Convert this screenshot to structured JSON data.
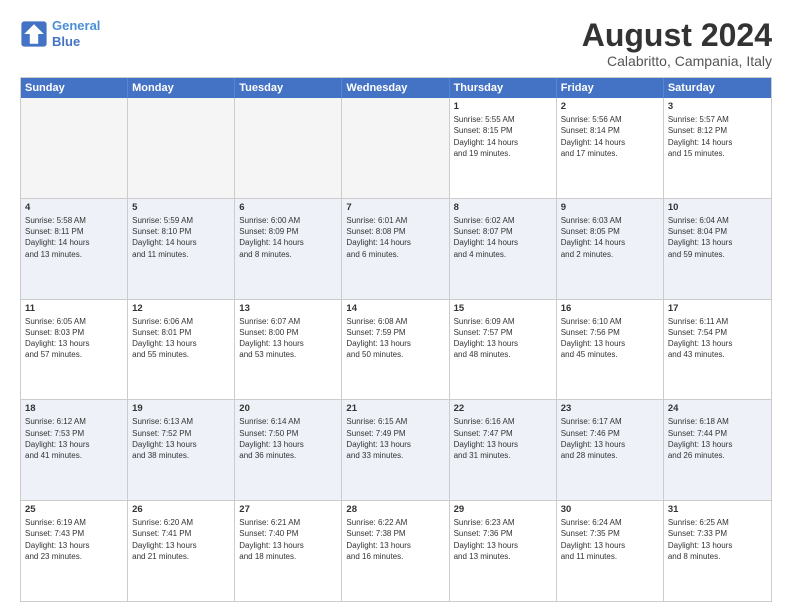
{
  "logo": {
    "line1": "General",
    "line2": "Blue"
  },
  "title": "August 2024",
  "subtitle": "Calabritto, Campania, Italy",
  "weekdays": [
    "Sunday",
    "Monday",
    "Tuesday",
    "Wednesday",
    "Thursday",
    "Friday",
    "Saturday"
  ],
  "rows": [
    {
      "alt": false,
      "cells": [
        {
          "empty": true,
          "day": "",
          "info": ""
        },
        {
          "empty": true,
          "day": "",
          "info": ""
        },
        {
          "empty": true,
          "day": "",
          "info": ""
        },
        {
          "empty": true,
          "day": "",
          "info": ""
        },
        {
          "empty": false,
          "day": "1",
          "info": "Sunrise: 5:55 AM\nSunset: 8:15 PM\nDaylight: 14 hours\nand 19 minutes."
        },
        {
          "empty": false,
          "day": "2",
          "info": "Sunrise: 5:56 AM\nSunset: 8:14 PM\nDaylight: 14 hours\nand 17 minutes."
        },
        {
          "empty": false,
          "day": "3",
          "info": "Sunrise: 5:57 AM\nSunset: 8:12 PM\nDaylight: 14 hours\nand 15 minutes."
        }
      ]
    },
    {
      "alt": true,
      "cells": [
        {
          "empty": false,
          "day": "4",
          "info": "Sunrise: 5:58 AM\nSunset: 8:11 PM\nDaylight: 14 hours\nand 13 minutes."
        },
        {
          "empty": false,
          "day": "5",
          "info": "Sunrise: 5:59 AM\nSunset: 8:10 PM\nDaylight: 14 hours\nand 11 minutes."
        },
        {
          "empty": false,
          "day": "6",
          "info": "Sunrise: 6:00 AM\nSunset: 8:09 PM\nDaylight: 14 hours\nand 8 minutes."
        },
        {
          "empty": false,
          "day": "7",
          "info": "Sunrise: 6:01 AM\nSunset: 8:08 PM\nDaylight: 14 hours\nand 6 minutes."
        },
        {
          "empty": false,
          "day": "8",
          "info": "Sunrise: 6:02 AM\nSunset: 8:07 PM\nDaylight: 14 hours\nand 4 minutes."
        },
        {
          "empty": false,
          "day": "9",
          "info": "Sunrise: 6:03 AM\nSunset: 8:05 PM\nDaylight: 14 hours\nand 2 minutes."
        },
        {
          "empty": false,
          "day": "10",
          "info": "Sunrise: 6:04 AM\nSunset: 8:04 PM\nDaylight: 13 hours\nand 59 minutes."
        }
      ]
    },
    {
      "alt": false,
      "cells": [
        {
          "empty": false,
          "day": "11",
          "info": "Sunrise: 6:05 AM\nSunset: 8:03 PM\nDaylight: 13 hours\nand 57 minutes."
        },
        {
          "empty": false,
          "day": "12",
          "info": "Sunrise: 6:06 AM\nSunset: 8:01 PM\nDaylight: 13 hours\nand 55 minutes."
        },
        {
          "empty": false,
          "day": "13",
          "info": "Sunrise: 6:07 AM\nSunset: 8:00 PM\nDaylight: 13 hours\nand 53 minutes."
        },
        {
          "empty": false,
          "day": "14",
          "info": "Sunrise: 6:08 AM\nSunset: 7:59 PM\nDaylight: 13 hours\nand 50 minutes."
        },
        {
          "empty": false,
          "day": "15",
          "info": "Sunrise: 6:09 AM\nSunset: 7:57 PM\nDaylight: 13 hours\nand 48 minutes."
        },
        {
          "empty": false,
          "day": "16",
          "info": "Sunrise: 6:10 AM\nSunset: 7:56 PM\nDaylight: 13 hours\nand 45 minutes."
        },
        {
          "empty": false,
          "day": "17",
          "info": "Sunrise: 6:11 AM\nSunset: 7:54 PM\nDaylight: 13 hours\nand 43 minutes."
        }
      ]
    },
    {
      "alt": true,
      "cells": [
        {
          "empty": false,
          "day": "18",
          "info": "Sunrise: 6:12 AM\nSunset: 7:53 PM\nDaylight: 13 hours\nand 41 minutes."
        },
        {
          "empty": false,
          "day": "19",
          "info": "Sunrise: 6:13 AM\nSunset: 7:52 PM\nDaylight: 13 hours\nand 38 minutes."
        },
        {
          "empty": false,
          "day": "20",
          "info": "Sunrise: 6:14 AM\nSunset: 7:50 PM\nDaylight: 13 hours\nand 36 minutes."
        },
        {
          "empty": false,
          "day": "21",
          "info": "Sunrise: 6:15 AM\nSunset: 7:49 PM\nDaylight: 13 hours\nand 33 minutes."
        },
        {
          "empty": false,
          "day": "22",
          "info": "Sunrise: 6:16 AM\nSunset: 7:47 PM\nDaylight: 13 hours\nand 31 minutes."
        },
        {
          "empty": false,
          "day": "23",
          "info": "Sunrise: 6:17 AM\nSunset: 7:46 PM\nDaylight: 13 hours\nand 28 minutes."
        },
        {
          "empty": false,
          "day": "24",
          "info": "Sunrise: 6:18 AM\nSunset: 7:44 PM\nDaylight: 13 hours\nand 26 minutes."
        }
      ]
    },
    {
      "alt": false,
      "cells": [
        {
          "empty": false,
          "day": "25",
          "info": "Sunrise: 6:19 AM\nSunset: 7:43 PM\nDaylight: 13 hours\nand 23 minutes."
        },
        {
          "empty": false,
          "day": "26",
          "info": "Sunrise: 6:20 AM\nSunset: 7:41 PM\nDaylight: 13 hours\nand 21 minutes."
        },
        {
          "empty": false,
          "day": "27",
          "info": "Sunrise: 6:21 AM\nSunset: 7:40 PM\nDaylight: 13 hours\nand 18 minutes."
        },
        {
          "empty": false,
          "day": "28",
          "info": "Sunrise: 6:22 AM\nSunset: 7:38 PM\nDaylight: 13 hours\nand 16 minutes."
        },
        {
          "empty": false,
          "day": "29",
          "info": "Sunrise: 6:23 AM\nSunset: 7:36 PM\nDaylight: 13 hours\nand 13 minutes."
        },
        {
          "empty": false,
          "day": "30",
          "info": "Sunrise: 6:24 AM\nSunset: 7:35 PM\nDaylight: 13 hours\nand 11 minutes."
        },
        {
          "empty": false,
          "day": "31",
          "info": "Sunrise: 6:25 AM\nSunset: 7:33 PM\nDaylight: 13 hours\nand 8 minutes."
        }
      ]
    }
  ]
}
